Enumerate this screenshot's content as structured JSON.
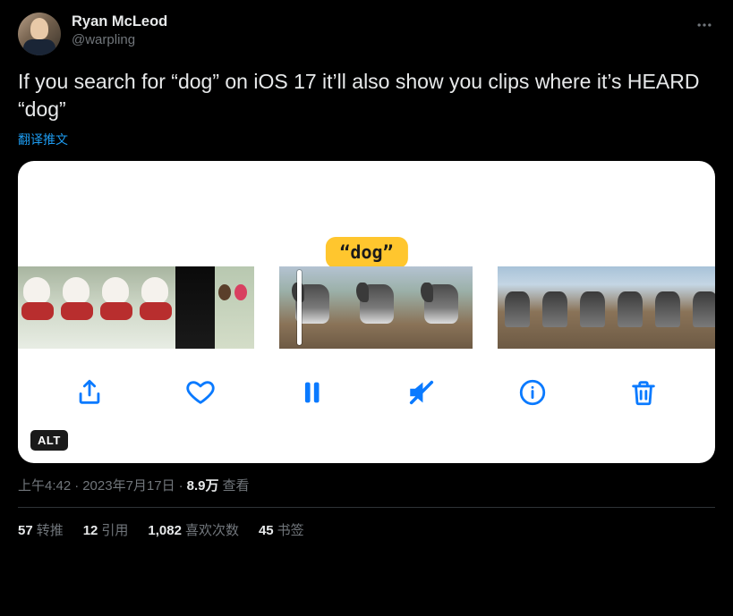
{
  "user": {
    "display_name": "Ryan McLeod",
    "handle": "@warpling"
  },
  "tweet_text": "If you search for “dog” on iOS 17 it’ll also show you clips where it’s HEARD “dog”",
  "translate_label": "翻译推文",
  "media": {
    "caption_tag": "“dog”",
    "alt_badge": "ALT",
    "toolbar_icons": [
      "share",
      "heart",
      "pause",
      "mute",
      "info",
      "trash"
    ]
  },
  "timestamp": {
    "time": "上午4:42",
    "sep1": " · ",
    "date": "2023年7月17日",
    "sep2": " · ",
    "views_count": "8.9万",
    "views_label": " 查看"
  },
  "engagement": {
    "retweets": {
      "count": "57",
      "label": "转推"
    },
    "quotes": {
      "count": "12",
      "label": "引用"
    },
    "likes": {
      "count": "1,082",
      "label": "喜欢次数"
    },
    "bookmarks": {
      "count": "45",
      "label": "书签"
    }
  }
}
